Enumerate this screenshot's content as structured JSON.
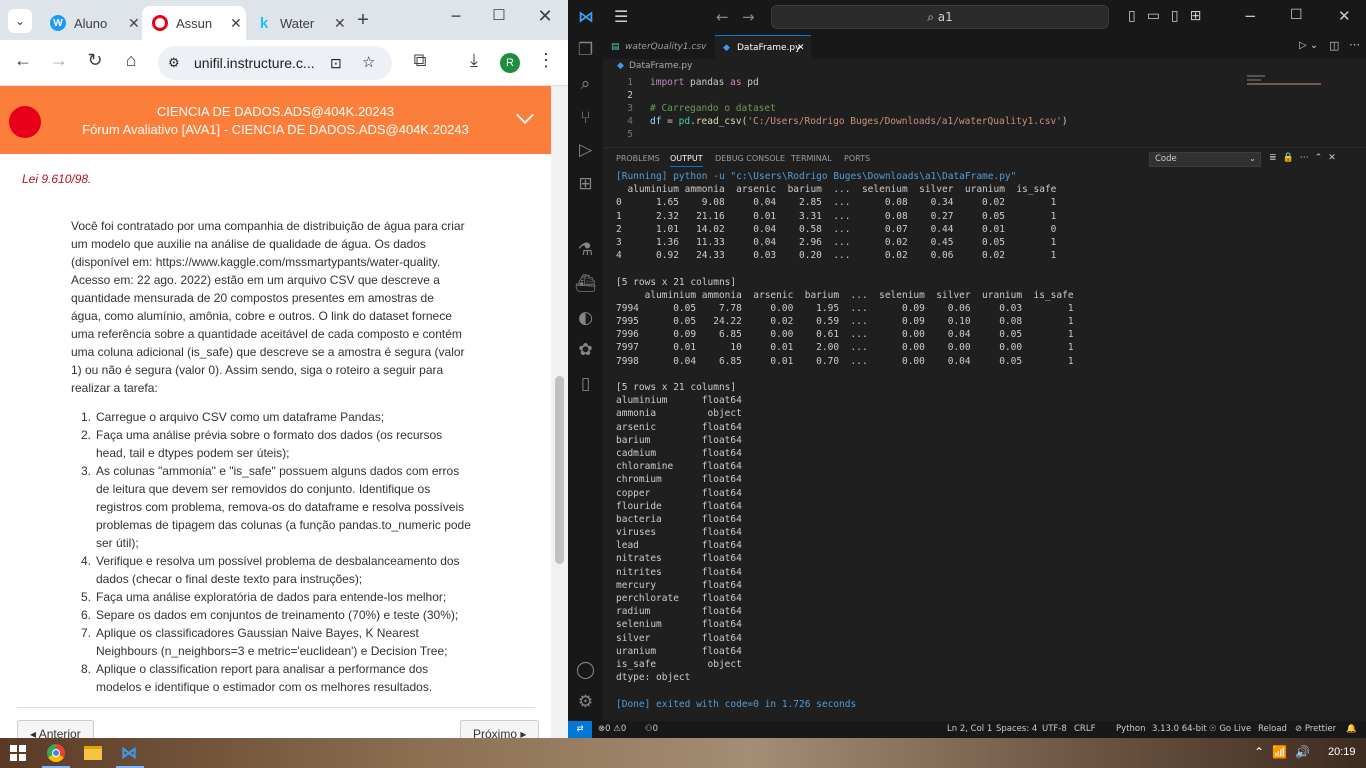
{
  "chrome": {
    "tabs": [
      {
        "title": "Aluno",
        "icon": "w-app-icon",
        "color": "#1d9bf0"
      },
      {
        "title": "Assun",
        "icon": "canvas-icon",
        "color": "#e8001a"
      },
      {
        "title": "Water",
        "icon": "kaggle-icon",
        "color": "#20beff"
      }
    ],
    "url": "unifil.instructure.c...",
    "profile_initial": "R",
    "course_title": "CIENCIA DE DADOS.ADS@404K.20243",
    "course_subtitle": "Fórum Avaliativo [AVA1] - CIENCIA DE DADOS.ADS@404K.20243",
    "law_ref": "Lei 9.610/98.",
    "paragraph": "Você foi contratado por uma companhia de distribuição de água para criar um modelo que auxilie na análise de qualidade de água. Os dados (disponível em: https://www.kaggle.com/mssmartypants/water-quality. Acesso em: 22 ago. 2022) estão em um arquivo CSV que descreve a quantidade mensurada de 20 compostos presentes em amostras de água, como alumínio, amônia, cobre e outros. O link do dataset fornece uma referência sobre a quantidade aceitável de cada composto e contém uma coluna adicional (is_safe) que descreve se a amostra é segura (valor 1) ou não é segura (valor 0). Assim sendo, siga o roteiro a seguir para realizar a tarefa:",
    "tasks": [
      {
        "num": "1.",
        "text": "Carregue o arquivo CSV como um dataframe Pandas;"
      },
      {
        "num": "2.",
        "text": "Faça uma análise prévia sobre o formato dos dados (os recursos head, tail e dtypes podem ser úteis);"
      },
      {
        "num": "3.",
        "text": "As colunas \"ammonia\" e \"is_safe\" possuem alguns dados com erros de leitura que devem ser removidos do conjunto. Identifique os registros com problema, remova-os do dataframe e resolva possíveis problemas de tipagem das colunas (a função pandas.to_numeric pode ser útil);"
      },
      {
        "num": "4.",
        "text": "Verifique e resolva um possível problema de desbalanceamento dos dados (checar o final deste texto para instruções);"
      },
      {
        "num": "5.",
        "text": "Faça uma análise exploratória de dados para entende-los melhor;"
      },
      {
        "num": "6.",
        "text": "Separe os dados em conjuntos de treinamento (70%) e teste (30%);"
      },
      {
        "num": "7.",
        "text": "Aplique os classificadores Gaussian Naive Bayes, K Nearest Neighbours (n_neighbors=3 e metric='euclidean') e Decision Tree;"
      },
      {
        "num": "8.",
        "text": "Aplique o classification report para analisar a performance dos modelos e identifique o estimador com os melhores resultados."
      }
    ],
    "prev_label": "◂ Anterior",
    "next_label": "Próximo ▸"
  },
  "vscode": {
    "search": "a1",
    "tabs": [
      {
        "label": "waterQuality1.csv",
        "active": false
      },
      {
        "label": "DataFrame.py",
        "active": true
      }
    ],
    "breadcrumb": "DataFrame.py",
    "editor_lines": [
      {
        "n": "1",
        "code": "import pandas as pd"
      },
      {
        "n": "2",
        "code": ""
      },
      {
        "n": "3",
        "code": "# Carregando o dataset"
      },
      {
        "n": "4",
        "code": "df = pd.read_csv('C:/Users/Rodrigo Buges/Downloads/a1/waterQuality1.csv')"
      },
      {
        "n": "5",
        "code": ""
      }
    ],
    "panel_tabs": [
      "PROBLEMS",
      "OUTPUT",
      "DEBUG CONSOLE",
      "TERMINAL",
      "PORTS"
    ],
    "output_channel": "Code",
    "output_lines": [
      "[Running] python -u \"c:\\Users\\Rodrigo Buges\\Downloads\\a1\\DataFrame.py\"",
      "  aluminium ammonia  arsenic  barium  ...  selenium  silver  uranium  is_safe",
      "0      1.65    9.08     0.04    2.85  ...      0.08    0.34     0.02        1",
      "1      2.32   21.16     0.01    3.31  ...      0.08    0.27     0.05        1",
      "2      1.01   14.02     0.04    0.58  ...      0.07    0.44     0.01        0",
      "3      1.36   11.33     0.04    2.96  ...      0.02    0.45     0.05        1",
      "4      0.92   24.33     0.03    0.20  ...      0.02    0.06     0.02        1",
      "",
      "[5 rows x 21 columns]",
      "     aluminium ammonia  arsenic  barium  ...  selenium  silver  uranium  is_safe",
      "7994      0.05    7.78     0.00    1.95  ...      0.09    0.06     0.03        1",
      "7995      0.05   24.22     0.02    0.59  ...      0.09    0.10     0.08        1",
      "7996      0.09    6.85     0.00    0.61  ...      0.00    0.04     0.05        1",
      "7997      0.01      10     0.01    2.00  ...      0.00    0.00     0.00        1",
      "7998      0.04    6.85     0.01    0.70  ...      0.00    0.04     0.05        1",
      "",
      "[5 rows x 21 columns]",
      "aluminium      float64",
      "ammonia         object",
      "arsenic        float64",
      "barium         float64",
      "cadmium        float64",
      "chloramine     float64",
      "chromium       float64",
      "copper         float64",
      "flouride       float64",
      "bacteria       float64",
      "viruses        float64",
      "lead           float64",
      "nitrates       float64",
      "nitrites       float64",
      "mercury        float64",
      "perchlorate    float64",
      "radium         float64",
      "selenium       float64",
      "silver         float64",
      "uranium        float64",
      "is_safe         object",
      "dtype: object",
      "",
      "[Done] exited with code=0 in 1.726 seconds"
    ],
    "status": {
      "errors": "⊗0 ⚠0",
      "ports": "⚇0",
      "position": "Ln 2, Col 1",
      "spaces": "Spaces: 4",
      "encoding": "UTF-8",
      "eol": "CRLF",
      "language": "Python",
      "interpreter": "3.13.0 64-bit",
      "golive": "Go Live",
      "reload": "Reload",
      "prettier": "Prettier"
    }
  },
  "taskbar": {
    "time": "20:19"
  }
}
